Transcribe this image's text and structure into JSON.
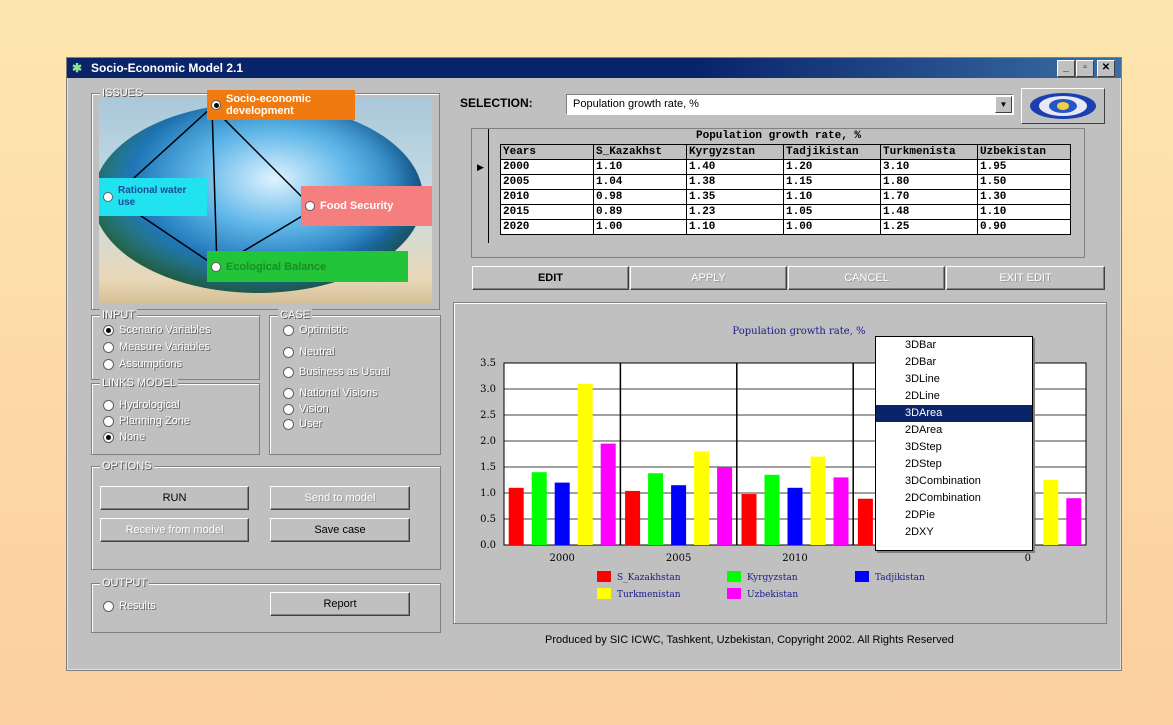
{
  "window": {
    "title": "Socio-Economic Model 2.1",
    "buttons": [
      "_",
      "▫",
      "✕"
    ]
  },
  "issues": {
    "label": "ISSUES",
    "nodes": [
      {
        "text": "Socio-economic development",
        "color": "#f07a10"
      },
      {
        "text": "Rational water use",
        "color": "#21e3f0"
      },
      {
        "text": "Food Security",
        "color": "#f57f7f"
      },
      {
        "text": "Ecological Balance",
        "color": "#22c53a"
      }
    ]
  },
  "selection": {
    "label": "SELECTION:",
    "value": "Population growth rate, %"
  },
  "table": {
    "title": "Population growth rate, %",
    "columns": [
      "Years",
      "S_Kazakhst",
      "Kyrgyzstan",
      "Tadjikistan",
      "Turkmenista",
      "Uzbekistan"
    ],
    "rows": [
      [
        "2000",
        "1.10",
        "1.40",
        "1.20",
        "3.10",
        "1.95"
      ],
      [
        "2005",
        "1.04",
        "1.38",
        "1.15",
        "1.80",
        "1.50"
      ],
      [
        "2010",
        "0.98",
        "1.35",
        "1.10",
        "1.70",
        "1.30"
      ],
      [
        "2015",
        "0.89",
        "1.23",
        "1.05",
        "1.48",
        "1.10"
      ],
      [
        "2020",
        "1.00",
        "1.10",
        "1.00",
        "1.25",
        "0.90"
      ]
    ],
    "current_row_marker": "▶"
  },
  "edit_buttons": {
    "edit": "EDIT",
    "apply": "APPLY",
    "cancel": "CANCEL",
    "exit": "EXIT EDIT"
  },
  "input": {
    "label": "INPUT",
    "options": [
      "Scenario Variables",
      "Measure Variables",
      "Assumptions"
    ],
    "selected": 0
  },
  "case": {
    "label": "CASE",
    "options": [
      "Optimistic",
      "Neutral",
      "Business as Usual",
      "National Visions",
      "Vision",
      "User"
    ]
  },
  "links_model": {
    "label": "LINKS MODEL",
    "options": [
      "Hydrological",
      "Planning Zone",
      "None"
    ],
    "selected": 2
  },
  "options": {
    "label": "OPTIONS",
    "run": "RUN",
    "send": "Send to model",
    "receive": "Receive from model",
    "save": "Save case"
  },
  "output": {
    "label": "OUTPUT",
    "results": "Results",
    "report": "Report"
  },
  "chart_data": {
    "type": "bar",
    "title": "Population growth rate, %",
    "categories": [
      "2000",
      "2005",
      "2010",
      "2015",
      "2020"
    ],
    "visible_tick_labels": [
      "2000",
      "2005",
      "2010",
      "",
      "0"
    ],
    "series": [
      {
        "name": "S_Kazakhstan",
        "color": "#ff0000",
        "values": [
          1.1,
          1.04,
          0.98,
          0.89,
          1.0
        ]
      },
      {
        "name": "Kyrgyzstan",
        "color": "#00ff00",
        "values": [
          1.4,
          1.38,
          1.35,
          1.23,
          1.1
        ]
      },
      {
        "name": "Tadjikistan",
        "color": "#0000ff",
        "values": [
          1.2,
          1.15,
          1.1,
          1.05,
          1.0
        ]
      },
      {
        "name": "Turkmenistan",
        "color": "#ffff00",
        "values": [
          3.1,
          1.8,
          1.7,
          1.48,
          1.25
        ]
      },
      {
        "name": "Uzbekistan",
        "color": "#ff00ff",
        "values": [
          1.95,
          1.5,
          1.3,
          1.1,
          0.9
        ]
      }
    ],
    "yticks": [
      "3.5",
      "3.0",
      "2.5",
      "2.0",
      "1.5",
      "1.0",
      "0.5",
      "0.0"
    ],
    "ylim": [
      0,
      3.5
    ],
    "grid": true,
    "legend_position": "bottom"
  },
  "chart_type_menu": {
    "items": [
      "3DBar",
      "2DBar",
      "3DLine",
      "2DLine",
      "3DArea",
      "2DArea",
      "3DStep",
      "2DStep",
      "3DCombination",
      "2DCombination",
      "2DPie",
      "2DXY"
    ],
    "selected": 4
  },
  "footer": "Produced by SIC ICWC, Tashkent, Uzbekistan, Copyright 2002. All Rights Reserved"
}
